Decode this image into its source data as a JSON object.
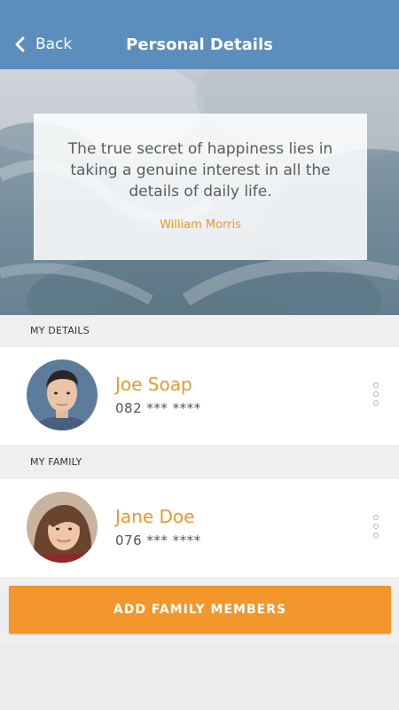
{
  "header": {
    "back_label": "Back",
    "title": "Personal Details"
  },
  "quote": {
    "text": "The true secret of happiness lies in taking a genuine interest in all the details of daily life.",
    "author": "William Morris"
  },
  "sections": {
    "my_details": "MY DETAILS",
    "my_family": "MY FAMILY"
  },
  "me": {
    "name": "Joe Soap",
    "phone": "082 *** ****"
  },
  "family": [
    {
      "name": "Jane Doe",
      "phone": "076 *** ****"
    }
  ],
  "actions": {
    "add_family": "ADD FAMILY MEMBERS"
  },
  "colors": {
    "header": "#5b8ebd",
    "accent": "#f3962b",
    "name": "#f0962a"
  }
}
